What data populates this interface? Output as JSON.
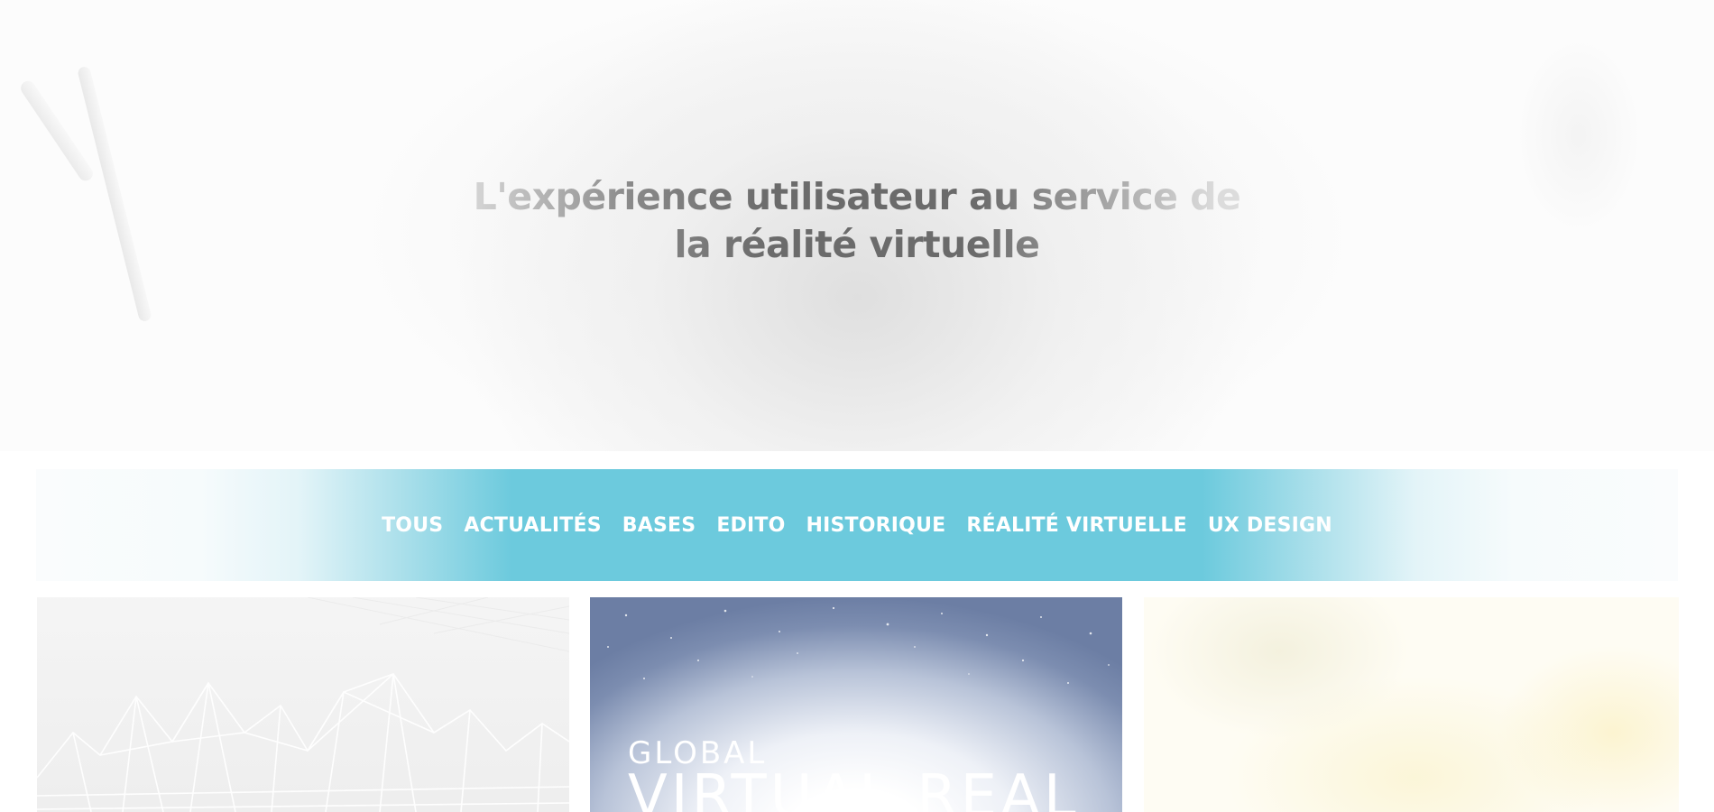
{
  "hero": {
    "title_line1": "L'expérience utilisateur au service de",
    "title_line2": "la réalité virtuelle"
  },
  "filters": {
    "items": [
      "TOUS",
      "ACTUALITÉS",
      "BASES",
      "EDITO",
      "HISTORIQUE",
      "RÉALITÉ VIRTUELLE",
      "UX DESIGN"
    ]
  },
  "cards": {
    "card_2": {
      "image_text_small": "GLOBAL",
      "image_text_big": "VIRTUAL REAL"
    }
  },
  "colors": {
    "accent": "#6ccadd",
    "hero_text": "#6b6b6b"
  }
}
